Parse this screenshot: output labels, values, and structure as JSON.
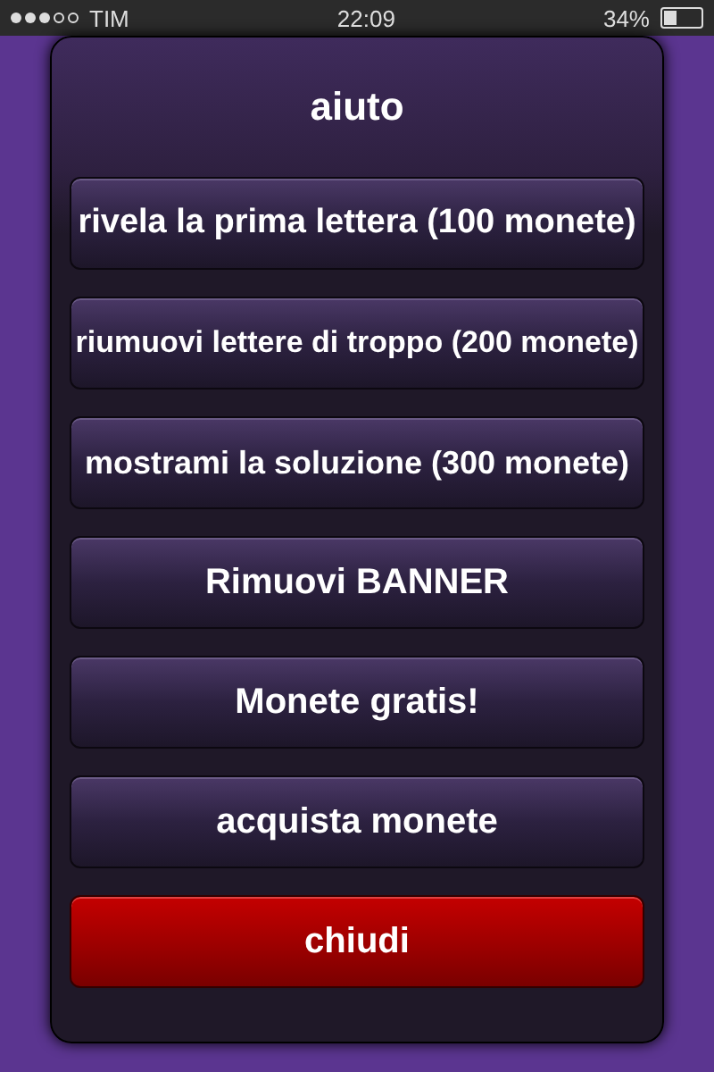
{
  "status_bar": {
    "carrier": "TIM",
    "time": "22:09",
    "battery": "34%"
  },
  "dialog": {
    "title": "aiuto",
    "buttons": [
      {
        "label": "rivela la prima lettera (100 monete)",
        "kind": "normal"
      },
      {
        "label": "riumuovi lettere di troppo (200 monete)",
        "kind": "normal"
      },
      {
        "label": "mostrami la soluzione (300 monete)",
        "kind": "normal"
      },
      {
        "label": "Rimuovi BANNER",
        "kind": "normal"
      },
      {
        "label": "Monete gratis!",
        "kind": "normal"
      },
      {
        "label": "acquista monete",
        "kind": "normal"
      },
      {
        "label": "chiudi",
        "kind": "cancel"
      }
    ]
  }
}
